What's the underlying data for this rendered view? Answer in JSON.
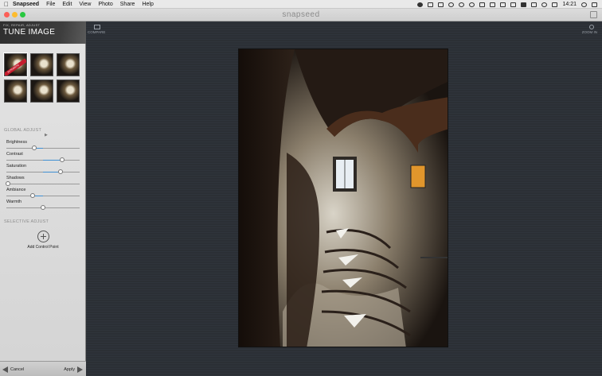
{
  "menubar": {
    "app_name": "Snapseed",
    "items": [
      "File",
      "Edit",
      "View",
      "Photo",
      "Share",
      "Help"
    ],
    "clock": "14:21"
  },
  "window": {
    "title": "snapseed"
  },
  "sidebar": {
    "breadcrumb": "FIX, REPAIR, ADJUST",
    "tool_title": "TUNE IMAGE",
    "automatic_label": "AUTOMATIC",
    "global_adjust": {
      "heading": "GLOBAL ADJUST",
      "sliders": [
        {
          "label": "Brightness",
          "value": 0.38,
          "center": 0.5
        },
        {
          "label": "Contrast",
          "value": 0.76,
          "center": 0.5
        },
        {
          "label": "Saturation",
          "value": 0.74,
          "center": 0.5
        },
        {
          "label": "Shadows",
          "value": 0.02,
          "center": 0.0
        },
        {
          "label": "Ambiance",
          "value": 0.36,
          "center": 0.5
        },
        {
          "label": "Warmth",
          "value": 0.5,
          "center": 0.5
        }
      ]
    },
    "selective_adjust": {
      "heading": "SELECTIVE ADJUST",
      "add_control_point": "Add Control Point"
    },
    "footer": {
      "cancel": "Cancel",
      "apply": "Apply"
    }
  },
  "toolbar": {
    "compare": "COMPARE",
    "zoom_in": "ZOOM IN"
  },
  "colors": {
    "accent": "#3f8fd2",
    "canvas_bg": "#2b2f35",
    "ribbon": "#c51c2d"
  }
}
